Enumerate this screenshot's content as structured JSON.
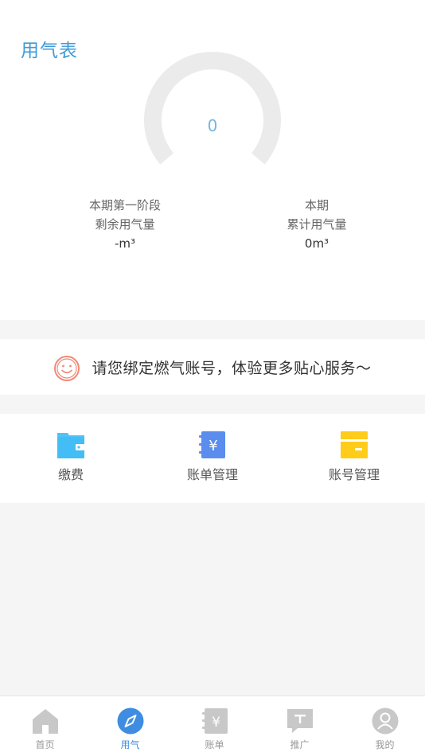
{
  "meter": {
    "title": "用气表",
    "gauge_value": "0",
    "left_stat": {
      "line1": "本期第一阶段",
      "line2": "剩余用气量",
      "value": "-m³"
    },
    "right_stat": {
      "line1": "本期",
      "line2": "累计用气量",
      "value": "0m³"
    }
  },
  "bind_prompt": {
    "icon": "smile-icon",
    "text": "请您绑定燃气账号，体验更多贴心服务～"
  },
  "actions": [
    {
      "label": "缴费",
      "icon": "wallet-icon",
      "color": "#4fc3f7"
    },
    {
      "label": "账单管理",
      "icon": "bill-icon",
      "color": "#5a8dee"
    },
    {
      "label": "账号管理",
      "icon": "account-card-icon",
      "color": "#ffcc1a"
    }
  ],
  "tabbar": {
    "active_color": "#3f8de0",
    "inactive_color": "#c8c8c8",
    "items": [
      {
        "label": "首页",
        "icon": "home-icon",
        "active": false
      },
      {
        "label": "用气",
        "icon": "compass-icon",
        "active": true
      },
      {
        "label": "账单",
        "icon": "bill-icon",
        "active": false
      },
      {
        "label": "推广",
        "icon": "promote-chat-icon",
        "active": false
      },
      {
        "label": "我的",
        "icon": "profile-icon",
        "active": false
      }
    ]
  }
}
